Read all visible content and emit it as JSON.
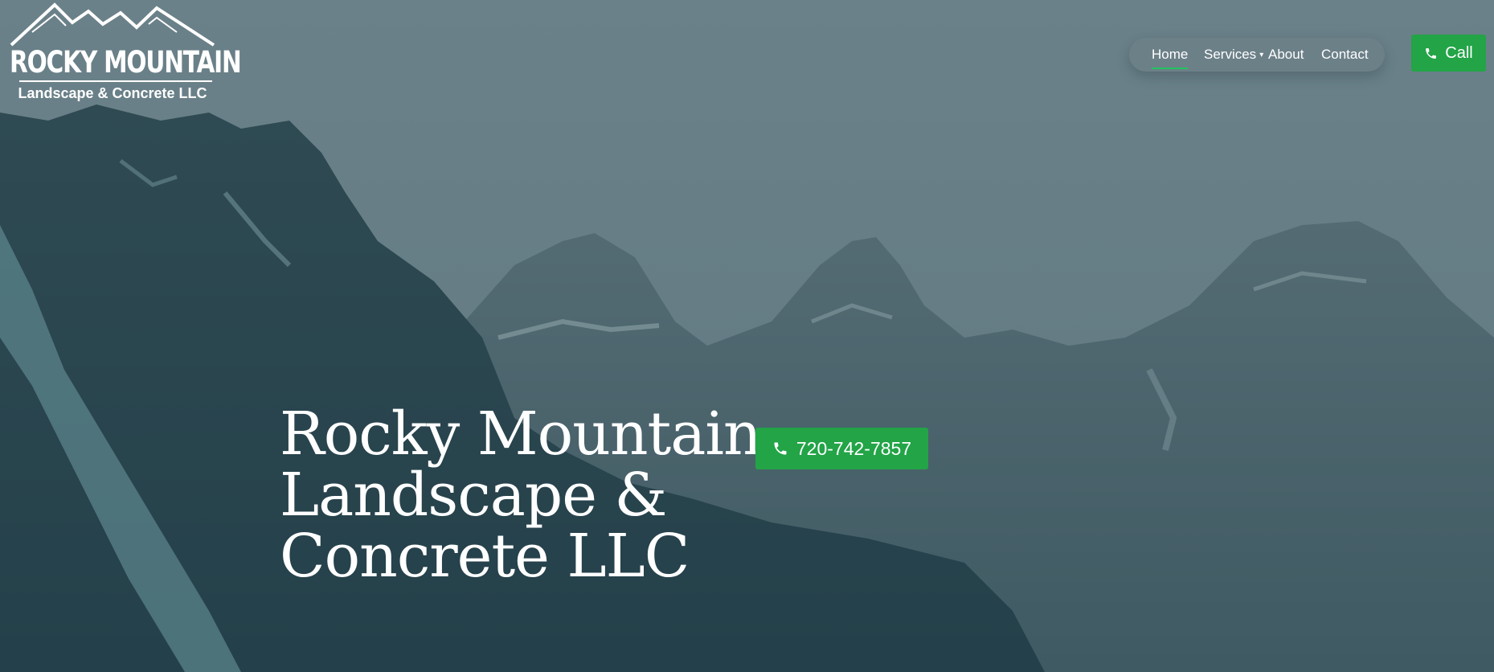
{
  "brand": {
    "logo_title": "ROCKY MOUNTAIN",
    "logo_subtitle": "Landscape & Concrete LLC"
  },
  "nav": {
    "items": [
      {
        "label": "Home",
        "active": true
      },
      {
        "label": "Services",
        "has_dropdown": true
      },
      {
        "label": "About"
      },
      {
        "label": "Contact"
      }
    ],
    "call_label": "Call"
  },
  "hero": {
    "title": "Rocky Mountain Landscape & Concrete LLC",
    "phone": "720-742-7857"
  },
  "colors": {
    "accent_green": "#22a447",
    "active_underline": "#22c55e",
    "text": "#ffffff"
  },
  "icons": {
    "phone": "phone-icon",
    "dropdown": "chevron-down-icon"
  }
}
